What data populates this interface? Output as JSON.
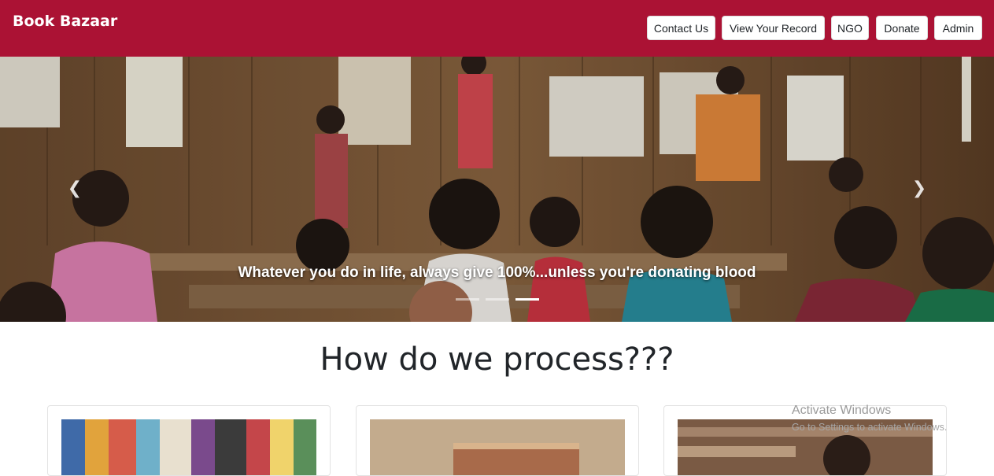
{
  "navbar": {
    "brand": "Book Bazaar",
    "links": [
      "Contact Us",
      "View Your Record",
      "NGO",
      "Donate",
      "Admin"
    ]
  },
  "carousel": {
    "caption": "Whatever you do in life, always give 100%...unless you're donating blood",
    "prev_icon": "chevron-left-icon",
    "next_icon": "chevron-right-icon",
    "slide_count": 3,
    "active_slide": 3
  },
  "process": {
    "title": "How do we process???",
    "cards": [
      "card-1",
      "card-2",
      "card-3"
    ]
  },
  "watermark": {
    "title": "Activate Windows",
    "subtitle": "Go to Settings to activate Windows."
  },
  "colors": {
    "navbar": "#ab1234",
    "accent": "#ffffff"
  }
}
